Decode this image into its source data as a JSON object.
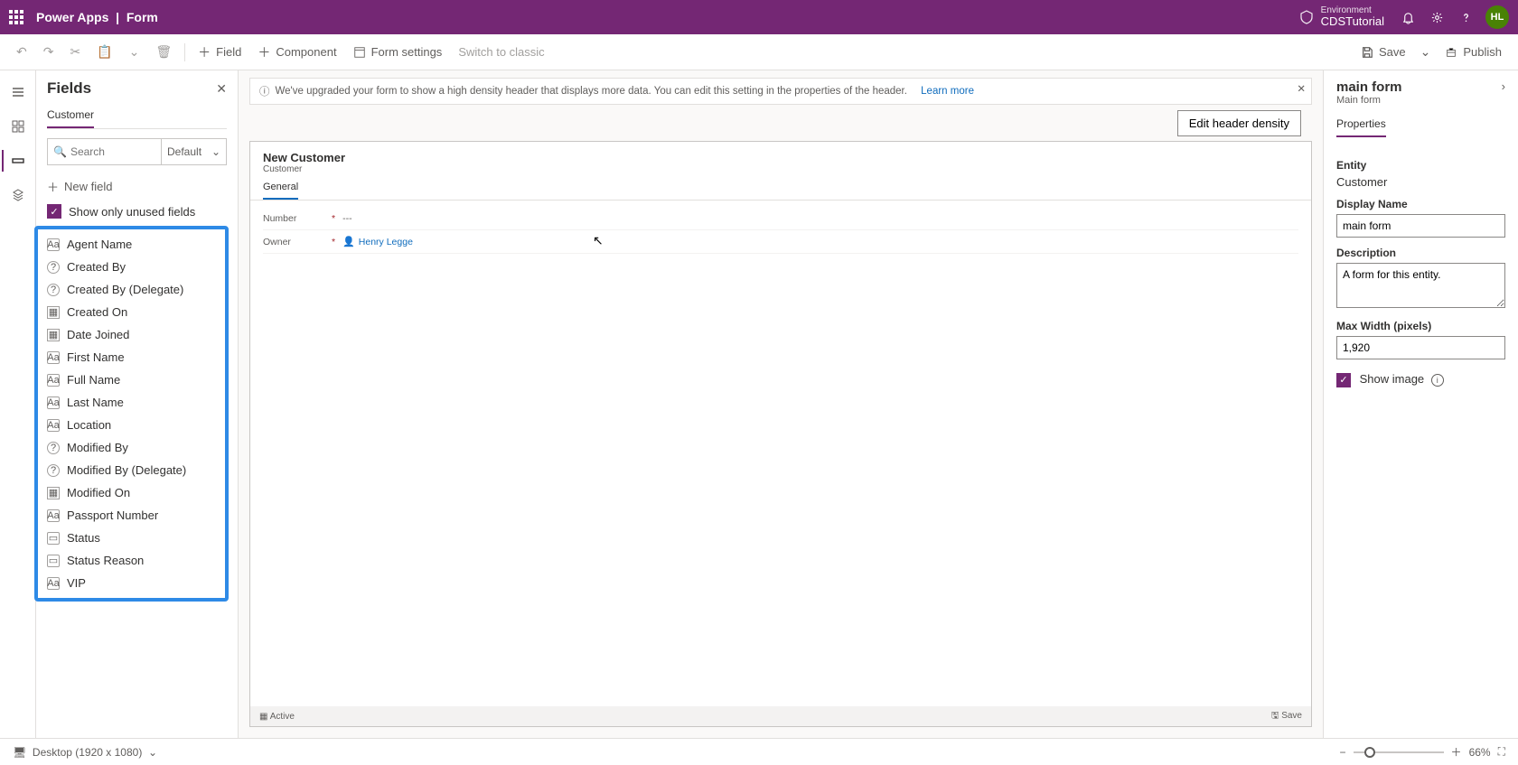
{
  "header": {
    "app_name": "Power Apps",
    "separator": "|",
    "page": "Form",
    "env_label": "Environment",
    "env_name": "CDSTutorial",
    "avatar": "HL"
  },
  "commands": {
    "field": "Field",
    "component": "Component",
    "form_settings": "Form settings",
    "switch_classic": "Switch to classic",
    "save": "Save",
    "publish": "Publish"
  },
  "fields_pane": {
    "title": "Fields",
    "tab": "Customer",
    "search_placeholder": "Search",
    "filter": "Default",
    "new_field": "New field",
    "show_unused": "Show only unused fields",
    "items": [
      {
        "icon": "text",
        "label": "Agent Name"
      },
      {
        "icon": "lookup",
        "label": "Created By"
      },
      {
        "icon": "lookup",
        "label": "Created By (Delegate)"
      },
      {
        "icon": "date",
        "label": "Created On"
      },
      {
        "icon": "date",
        "label": "Date Joined"
      },
      {
        "icon": "text",
        "label": "First Name"
      },
      {
        "icon": "text",
        "label": "Full Name"
      },
      {
        "icon": "text",
        "label": "Last Name"
      },
      {
        "icon": "text",
        "label": "Location"
      },
      {
        "icon": "lookup",
        "label": "Modified By"
      },
      {
        "icon": "lookup",
        "label": "Modified By (Delegate)"
      },
      {
        "icon": "date",
        "label": "Modified On"
      },
      {
        "icon": "text",
        "label": "Passport Number"
      },
      {
        "icon": "option",
        "label": "Status"
      },
      {
        "icon": "option",
        "label": "Status Reason"
      },
      {
        "icon": "text",
        "label": "VIP"
      }
    ]
  },
  "notice": {
    "text": "We've upgraded your form to show a high density header that displays more data. You can edit this setting in the properties of the header.",
    "link": "Learn more"
  },
  "density_button": "Edit header density",
  "form": {
    "title": "New Customer",
    "subtitle": "Customer",
    "tab": "General",
    "rows": [
      {
        "label": "Number",
        "required": true,
        "value": "---",
        "link": false
      },
      {
        "label": "Owner",
        "required": true,
        "value": "Henry Legge",
        "link": true
      }
    ],
    "footer_left": "Active",
    "footer_right": "Save"
  },
  "props": {
    "title": "main form",
    "subtitle": "Main form",
    "tab": "Properties",
    "entity_label": "Entity",
    "entity_value": "Customer",
    "display_name_label": "Display Name",
    "display_name_value": "main form",
    "description_label": "Description",
    "description_value": "A form for this entity.",
    "max_width_label": "Max Width (pixels)",
    "max_width_value": "1,920",
    "show_image": "Show image"
  },
  "status": {
    "viewport": "Desktop (1920 x 1080)",
    "zoom": "66%"
  }
}
